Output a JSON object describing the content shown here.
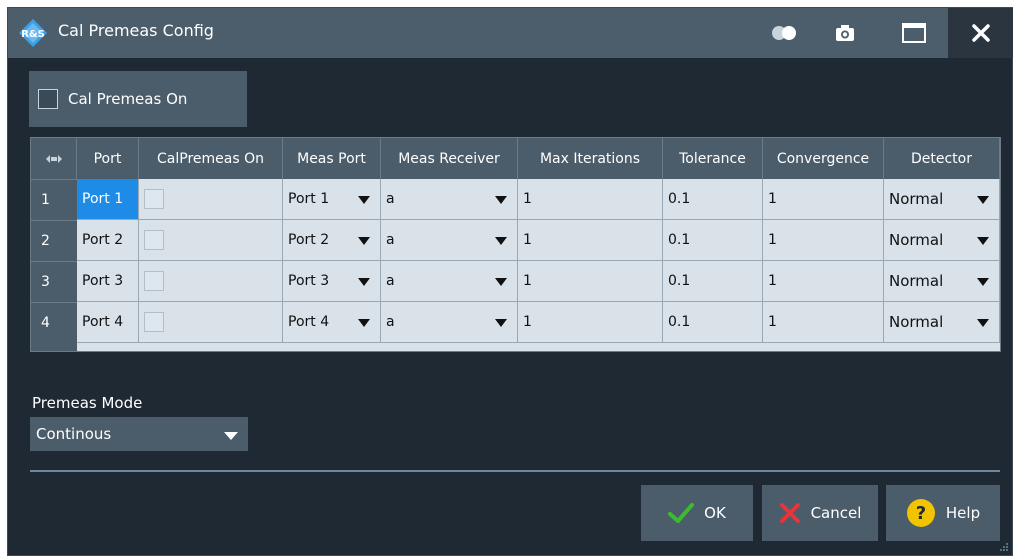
{
  "window": {
    "title": "Cal Premeas Config",
    "icons": [
      "rs-logo-icon",
      "toggle-icon",
      "camera-icon",
      "maximize-icon",
      "close-icon"
    ]
  },
  "cal_premeas_on": {
    "label": "Cal Premeas On",
    "checked": false
  },
  "table": {
    "columns": [
      "Port",
      "CalPremeas On",
      "Meas Port",
      "Meas Receiver",
      "Max Iterations",
      "Tolerance",
      "Convergence",
      "Detector"
    ],
    "rows": [
      {
        "num": "1",
        "port": "Port 1",
        "calpremeas_on": false,
        "meas_port": "Port 1",
        "meas_receiver": "a",
        "max_iterations": "1",
        "tolerance": "0.1",
        "convergence": "1",
        "detector": "Normal"
      },
      {
        "num": "2",
        "port": "Port 2",
        "calpremeas_on": false,
        "meas_port": "Port 2",
        "meas_receiver": "a",
        "max_iterations": "1",
        "tolerance": "0.1",
        "convergence": "1",
        "detector": "Normal"
      },
      {
        "num": "3",
        "port": "Port 3",
        "calpremeas_on": false,
        "meas_port": "Port 3",
        "meas_receiver": "a",
        "max_iterations": "1",
        "tolerance": "0.1",
        "convergence": "1",
        "detector": "Normal"
      },
      {
        "num": "4",
        "port": "Port 4",
        "calpremeas_on": false,
        "meas_port": "Port 4",
        "meas_receiver": "a",
        "max_iterations": "1",
        "tolerance": "0.1",
        "convergence": "1",
        "detector": "Normal"
      }
    ],
    "selected_cell": "Port 1"
  },
  "premeas_mode": {
    "label": "Premeas Mode",
    "value": "Continous"
  },
  "buttons": {
    "ok": "OK",
    "cancel": "Cancel",
    "help": "Help"
  },
  "colors": {
    "background": "#1f2933",
    "panel": "#4b5c6a",
    "titlebar": "#4c5d6b",
    "grid_cell": "#d9e2e9",
    "selection": "#1e8be6",
    "ok_check": "#3dbb2f",
    "cancel_x": "#e8343a",
    "help_yellow": "#f2c400"
  }
}
